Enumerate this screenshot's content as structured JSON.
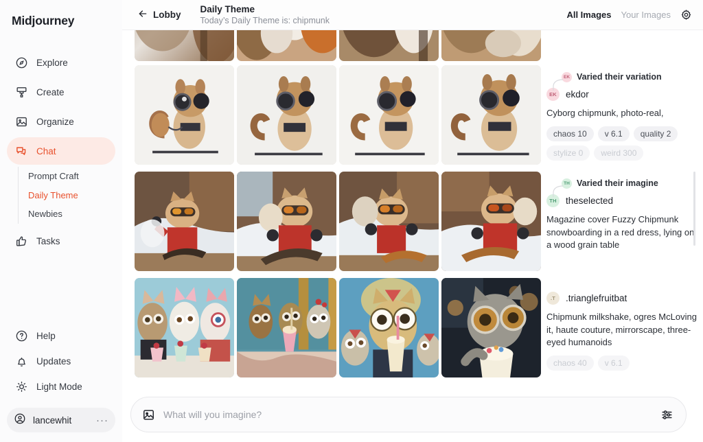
{
  "brand": "Midjourney",
  "colors": {
    "accent": "#e8512d",
    "accent_bg": "#fdeae5",
    "text": "#1d2027",
    "muted": "#8b8f98",
    "tag_bg": "#f1f1f4"
  },
  "sidebar": {
    "items": [
      {
        "label": "Explore",
        "icon": "compass-icon",
        "active": false
      },
      {
        "label": "Create",
        "icon": "brush-icon",
        "active": false
      },
      {
        "label": "Organize",
        "icon": "image-icon",
        "active": false
      },
      {
        "label": "Chat",
        "icon": "chat-bubbles-icon",
        "active": true
      }
    ],
    "subitems": [
      {
        "label": "Prompt Craft",
        "active": false
      },
      {
        "label": "Daily Theme",
        "active": true
      },
      {
        "label": "Newbies",
        "active": false
      }
    ],
    "tasks": {
      "label": "Tasks",
      "icon": "thumbs-up-icon"
    },
    "bottom_items": [
      {
        "label": "Help",
        "icon": "question-circle-icon"
      },
      {
        "label": "Updates",
        "icon": "bell-icon"
      },
      {
        "label": "Light Mode",
        "icon": "sun-icon"
      }
    ],
    "user": {
      "name": "lancewhit",
      "icon": "user-circle-icon",
      "menu": "···"
    }
  },
  "header": {
    "back_label": "Lobby",
    "back_icon": "arrow-left-icon",
    "title": "Daily Theme",
    "subtitle": "Today’s Daily Theme is: chipmunk",
    "tabs": [
      {
        "label": "All Images",
        "active": true
      },
      {
        "label": "Your Images",
        "active": false
      }
    ],
    "settings_icon": "gear-icon"
  },
  "feed": [
    {
      "id": "row-partial-top",
      "partial": true,
      "images": 4,
      "theme": "chipmunk-fur-closeup",
      "meta": null
    },
    {
      "id": "row-cyborg-chipmunk",
      "partial": false,
      "images": 4,
      "theme": "cyborg-chipmunk",
      "meta": {
        "varied_text": "Varied their variation",
        "avatar_initials": "EK",
        "avatar_bg": "#f9d9df",
        "avatar_fg": "#c06077",
        "author": "ekdor",
        "prompt": "Cyborg chipmunk, photo-real,",
        "tags": [
          {
            "label": "chaos 10",
            "faded": false
          },
          {
            "label": "v 6.1",
            "faded": false
          },
          {
            "label": "quality 2",
            "faded": false
          },
          {
            "label": "stylize 0",
            "faded": true
          },
          {
            "label": "weird 300",
            "faded": true
          }
        ]
      }
    },
    {
      "id": "row-snowboard-chipmunk",
      "partial": false,
      "images": 4,
      "theme": "snowboarding-chipmunk",
      "meta": {
        "varied_text": "Varied their imagine",
        "avatar_initials": "TH",
        "avatar_bg": "#d8f0e0",
        "avatar_fg": "#4d9c74",
        "author": "theselected",
        "prompt": "Magazine cover Fuzzy Chipmunk snowboarding in a red dress, lying on a wood grain table",
        "tags": []
      }
    },
    {
      "id": "row-milkshake-chipmunk",
      "partial": false,
      "images": 4,
      "theme": "milkshake-creatures",
      "meta": {
        "varied_text": null,
        "avatar_initials": ".T",
        "avatar_bg": "#efe8da",
        "avatar_fg": "#a09377",
        "author": ".trianglefruitbat",
        "prompt": "Chipmunk milkshake, ogres McLoving it, haute couture, mirrorscape, three-eyed humanoids",
        "tags": [
          {
            "label": "chaos 40",
            "faded": true
          },
          {
            "label": "v 6.1",
            "faded": true
          }
        ]
      }
    }
  ],
  "prompt_bar": {
    "placeholder": "What will you imagine?",
    "left_icon": "image-icon",
    "right_icon": "sliders-icon"
  }
}
